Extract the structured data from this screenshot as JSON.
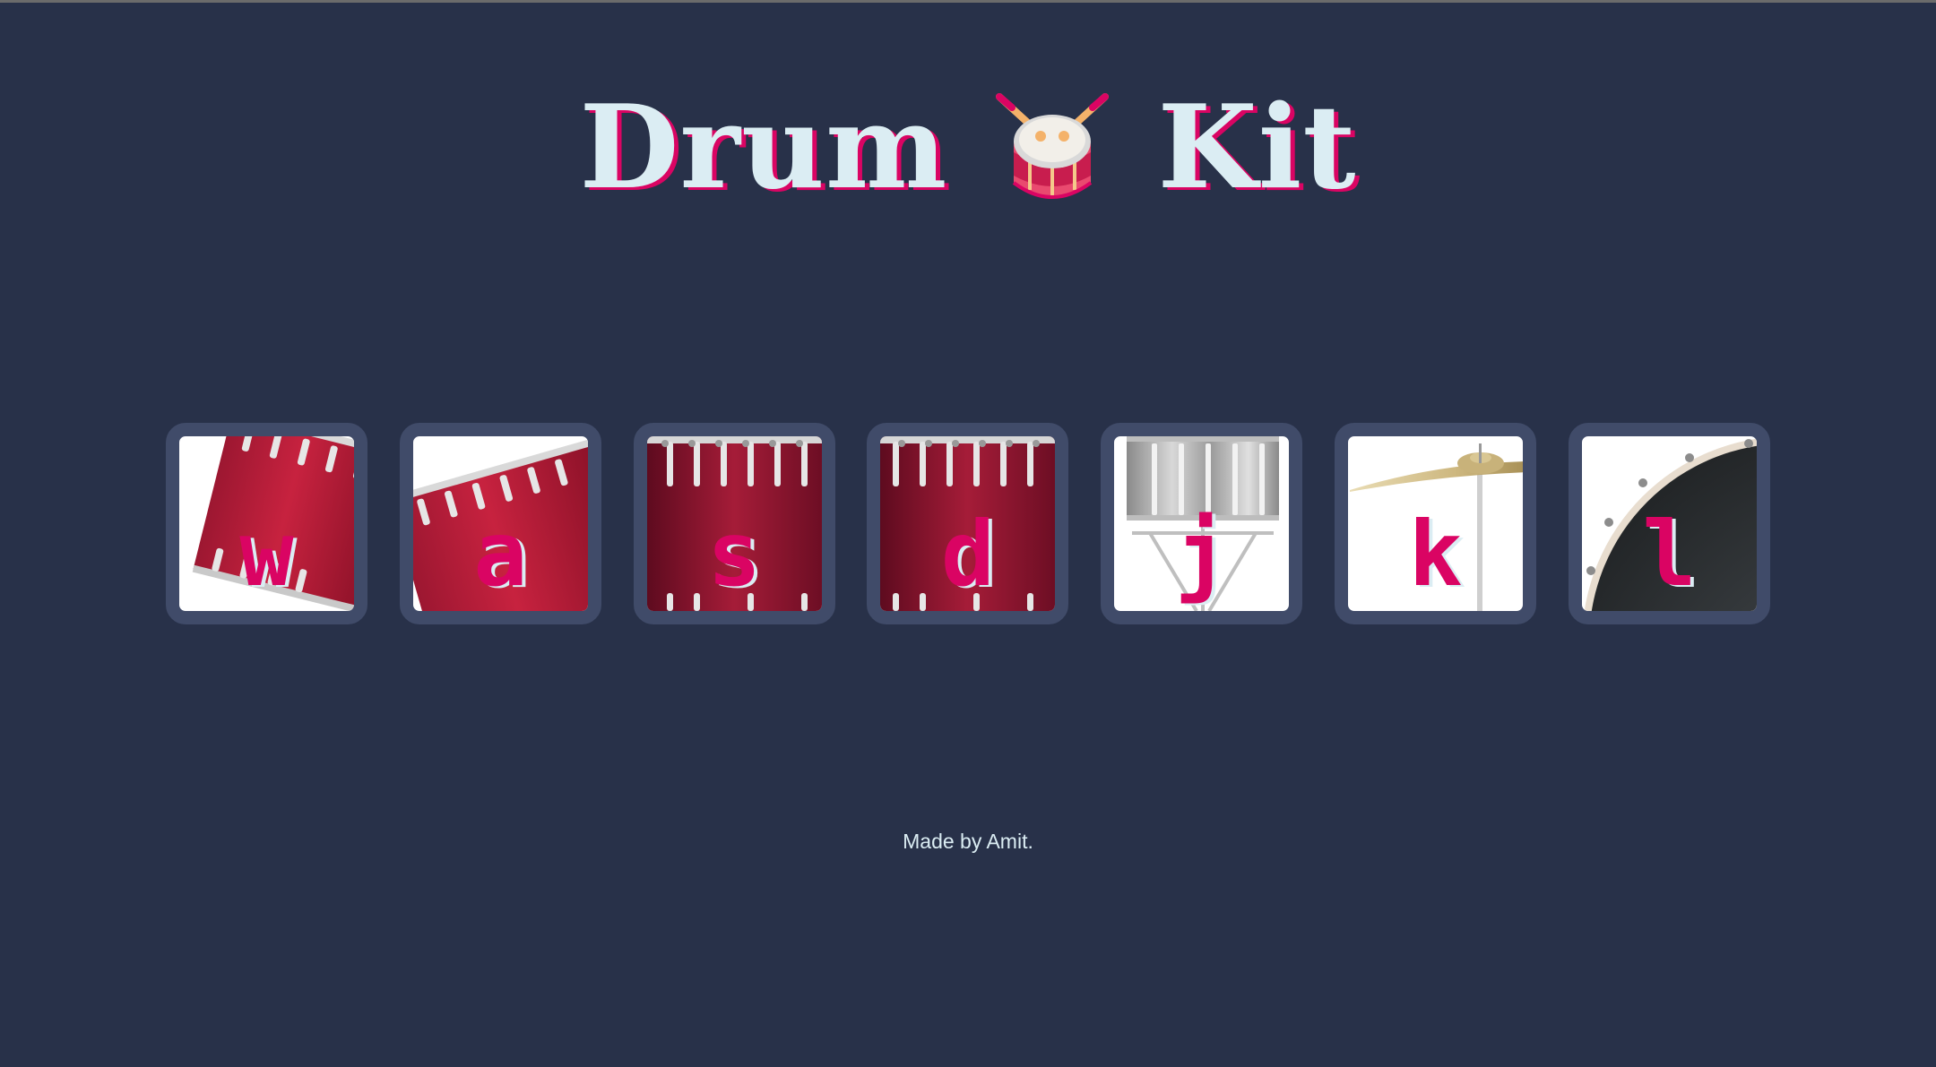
{
  "header": {
    "title_word_1": "Drum",
    "emoji_icon": "drum-icon",
    "title_word_2": "Kit"
  },
  "drums": [
    {
      "key": "w",
      "instrument": "tom-1",
      "icon": "tom-drum-icon"
    },
    {
      "key": "a",
      "instrument": "tom-2",
      "icon": "tom-drum-icon"
    },
    {
      "key": "s",
      "instrument": "tom-3",
      "icon": "floor-tom-icon"
    },
    {
      "key": "d",
      "instrument": "tom-4",
      "icon": "floor-tom-icon"
    },
    {
      "key": "j",
      "instrument": "snare",
      "icon": "snare-drum-icon"
    },
    {
      "key": "k",
      "instrument": "crash",
      "icon": "cymbal-icon"
    },
    {
      "key": "l",
      "instrument": "kick-bass",
      "icon": "bass-drum-icon"
    }
  ],
  "footer": {
    "text": "Made by Amit."
  },
  "colors": {
    "background": "#283149",
    "button_border": "#404b69",
    "accent": "#da0463",
    "text_light": "#dbedf3"
  }
}
